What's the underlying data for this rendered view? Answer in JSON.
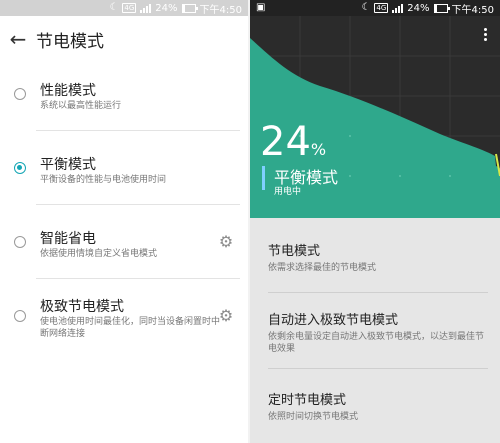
{
  "status": {
    "battery_pct": "24%",
    "time": "下午4:50",
    "network": "4G",
    "battery_level": 0.24
  },
  "left": {
    "title": "节电模式",
    "modes": [
      {
        "title": "性能模式",
        "desc": "系统以最高性能运行",
        "selected": false,
        "has_settings": false
      },
      {
        "title": "平衡模式",
        "desc": "平衡设备的性能与电池使用时间",
        "selected": true,
        "has_settings": false
      },
      {
        "title": "智能省电",
        "desc": "依据使用情境自定义省电模式",
        "selected": false,
        "has_settings": true
      },
      {
        "title": "极致节电模式",
        "desc": "使电池使用时间最佳化，同时当设备闲置时中断网络连接",
        "selected": false,
        "has_settings": true
      }
    ]
  },
  "right": {
    "battery_big": "24",
    "percent_sign": "%",
    "current_mode": "平衡模式",
    "charging_status": "用电中",
    "items": [
      {
        "title": "节电模式",
        "desc": "依需求选择最佳的节电模式"
      },
      {
        "title": "自动进入极致节电模式",
        "desc": "依剩余电量设定自动进入极致节电模式，以达到最佳节电效果"
      },
      {
        "title": "定时节电模式",
        "desc": "依照时间切换节电模式"
      }
    ]
  },
  "colors": {
    "accent": "#15a6b5",
    "graph_fill": "#2fa88c",
    "graph_bg": "#2b2b2b",
    "mode_indicator": "#7fd0ff"
  }
}
